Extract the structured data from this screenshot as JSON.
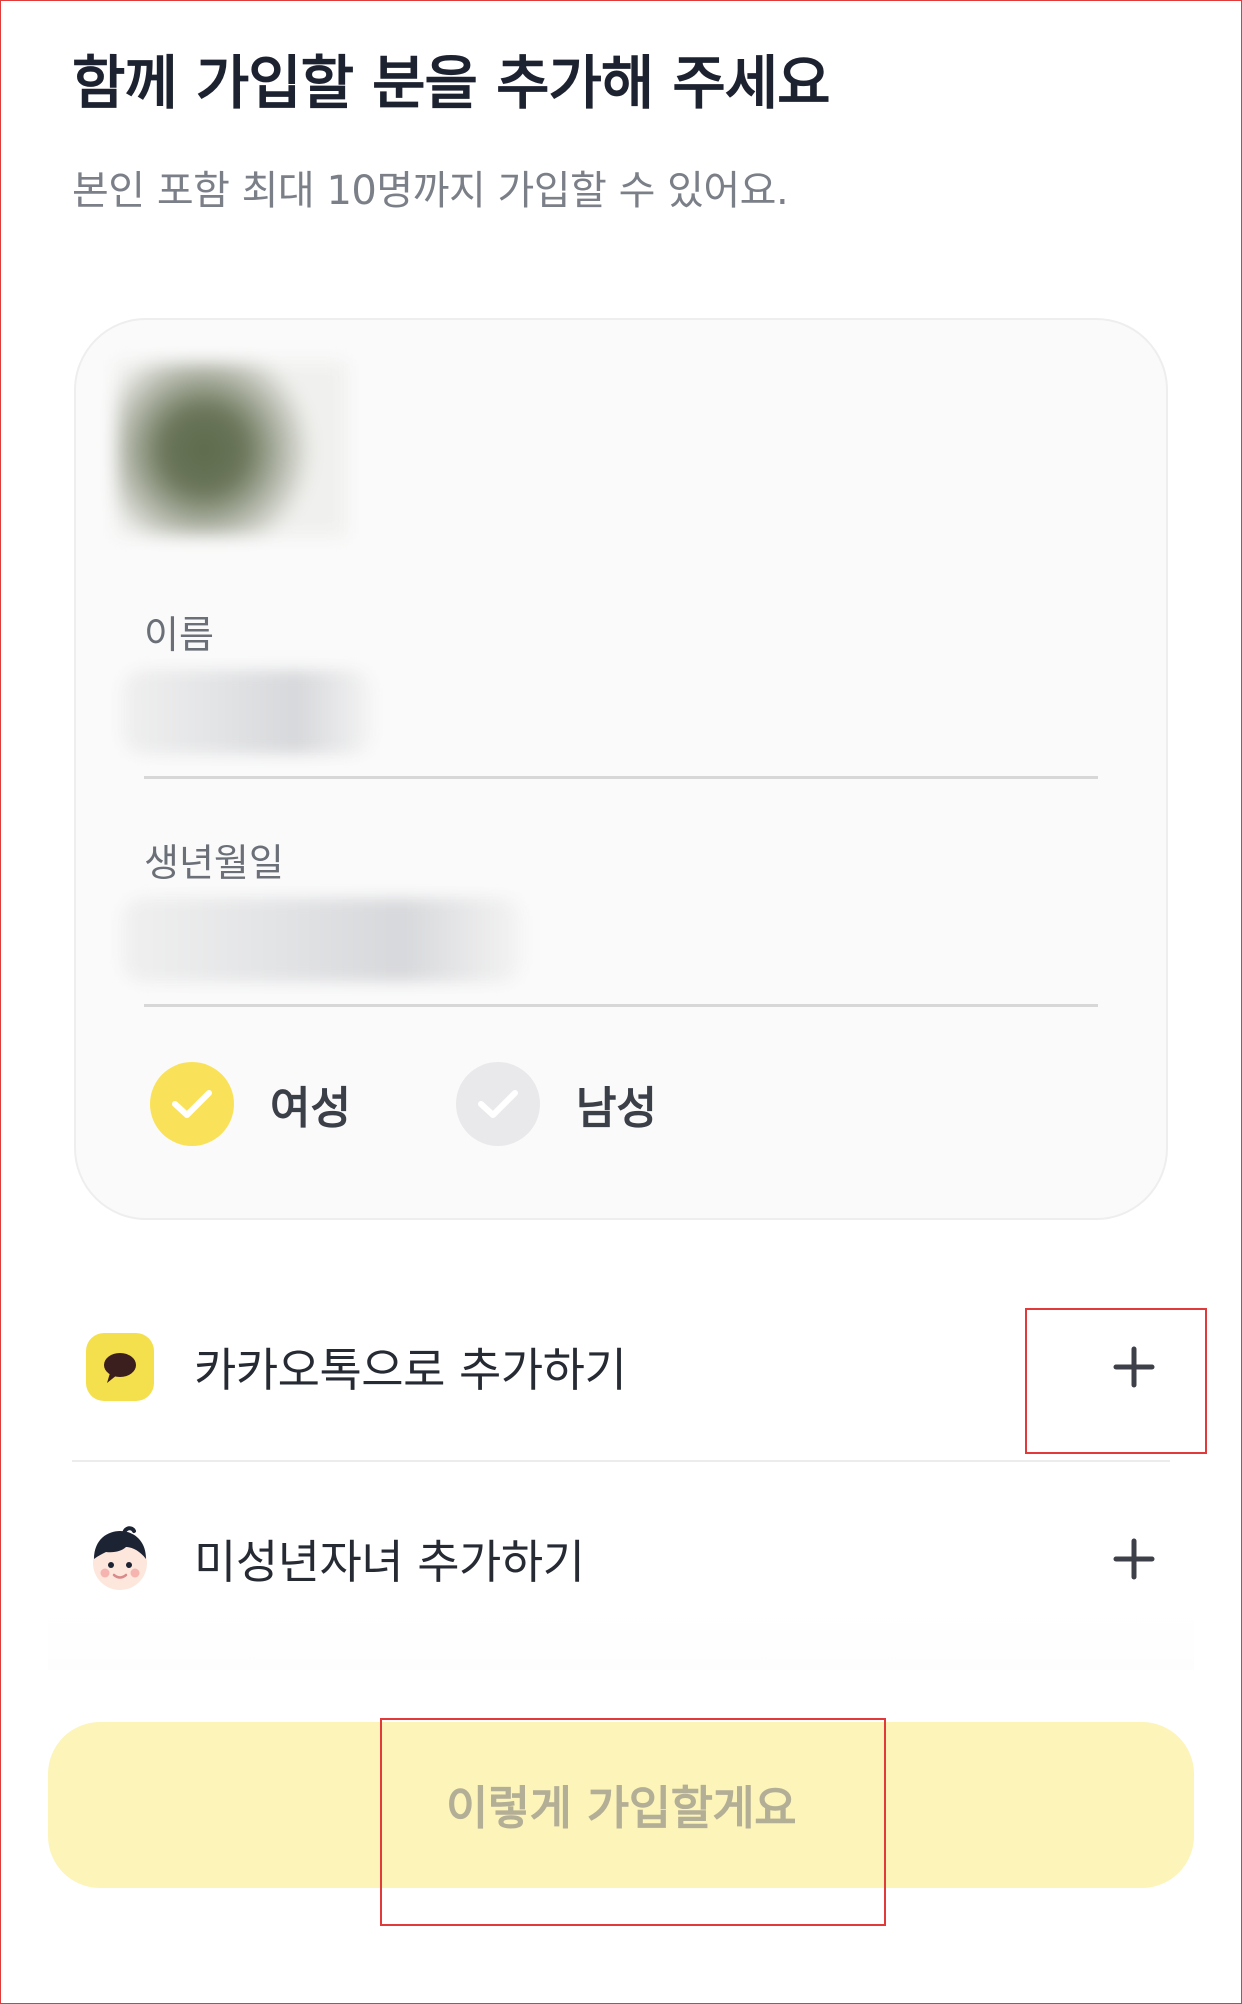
{
  "header": {
    "title": "함께 가입할 분을 추가해 주세요",
    "subtitle": "본인 포함 최대 10명까지 가입할 수 있어요."
  },
  "member_card": {
    "name_label": "이름",
    "name_value": "",
    "birth_label": "생년월일",
    "birth_value": "",
    "gender_options": [
      {
        "label": "여성",
        "selected": true
      },
      {
        "label": "남성",
        "selected": false
      }
    ]
  },
  "add_options": [
    {
      "label": "카카오톡으로 추가하기",
      "icon": "kakaotalk-icon"
    },
    {
      "label": "미성년자녀 추가하기",
      "icon": "child-avatar-icon"
    }
  ],
  "cta": {
    "label": "이렇게 가입할게요"
  },
  "colors": {
    "accent_yellow": "#f9e25a",
    "cta_background": "#fcf4b9",
    "cta_text": "#b3ae96",
    "highlight_border": "#e03a3a"
  }
}
